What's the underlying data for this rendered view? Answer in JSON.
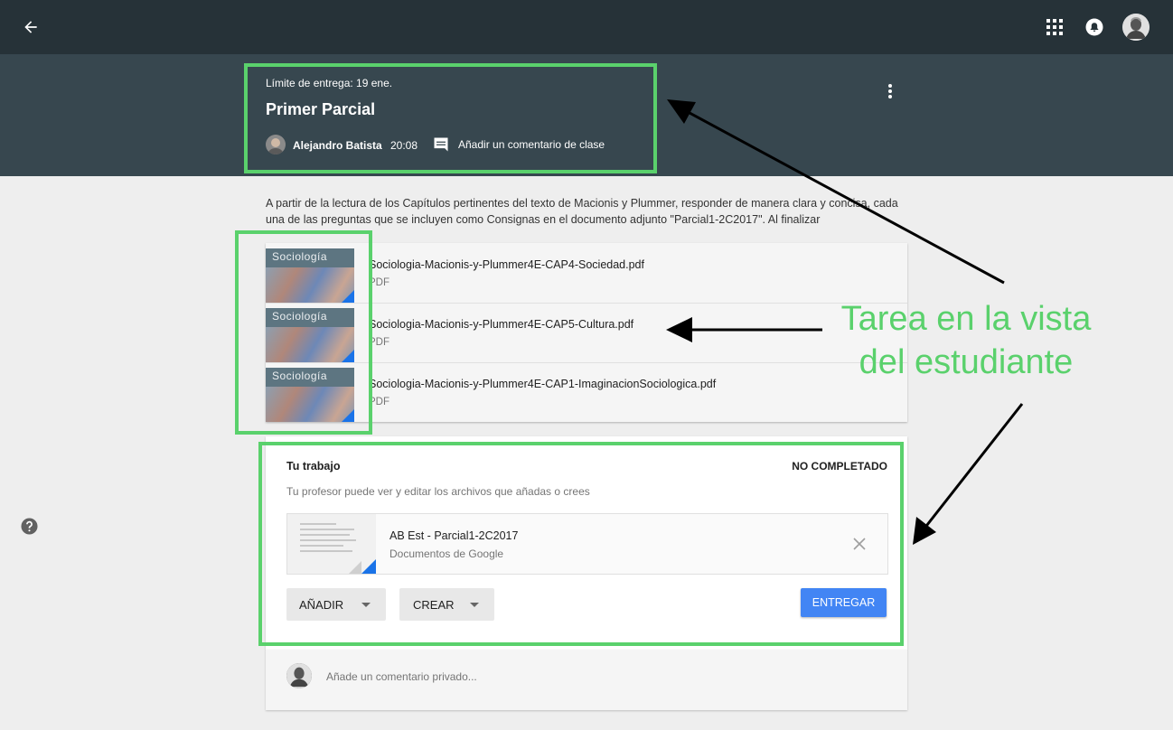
{
  "topbar": {
    "back_icon": "arrow-left-icon",
    "apps_icon": "apps-grid-icon",
    "notifications_icon": "bell-icon",
    "avatar_icon": "user-avatar"
  },
  "header": {
    "due": "Límite de entrega: 19 ene.",
    "title": "Primer Parcial",
    "author": "Alejandro Batista",
    "time": "20:08",
    "class_comment": "Añadir un comentario de clase",
    "more_icon": "more-vert-icon"
  },
  "description": "A partir de la lectura de los Capítulos pertinentes del texto de Macionis y Plummer, responder de manera clara y concisa, cada una de las preguntas que se incluyen como Consignas en el documento adjunto \"Parcial1-2C2017\". Al finalizar",
  "attachments": [
    {
      "thumb_text": "Sociología",
      "title": "Sociologia-Macionis-y-Plummer4E-CAP4-Sociedad.pdf",
      "type": "PDF"
    },
    {
      "thumb_text": "Sociología",
      "title": "Sociologia-Macionis-y-Plummer4E-CAP5-Cultura.pdf",
      "type": "PDF"
    },
    {
      "thumb_text": "Sociología",
      "title": "Sociologia-Macionis-y-Plummer4E-CAP1-ImaginacionSociologica.pdf",
      "type": "PDF"
    }
  ],
  "work": {
    "heading": "Tu trabajo",
    "status": "NO COMPLETADO",
    "hint": "Tu profesor puede ver y editar los archivos que añadas o crees",
    "file_title": "AB Est - Parcial1-2C2017",
    "file_type": "Documentos de Google",
    "add_label": "AÑADIR",
    "create_label": "CREAR",
    "submit_label": "ENTREGAR"
  },
  "private_comment": {
    "placeholder": "Añade un comentario privado..."
  },
  "annotation": {
    "line1": "Tarea en la vista",
    "line2": "del estudiante",
    "color": "#5ad16c"
  },
  "help_icon": "help-circle-icon"
}
